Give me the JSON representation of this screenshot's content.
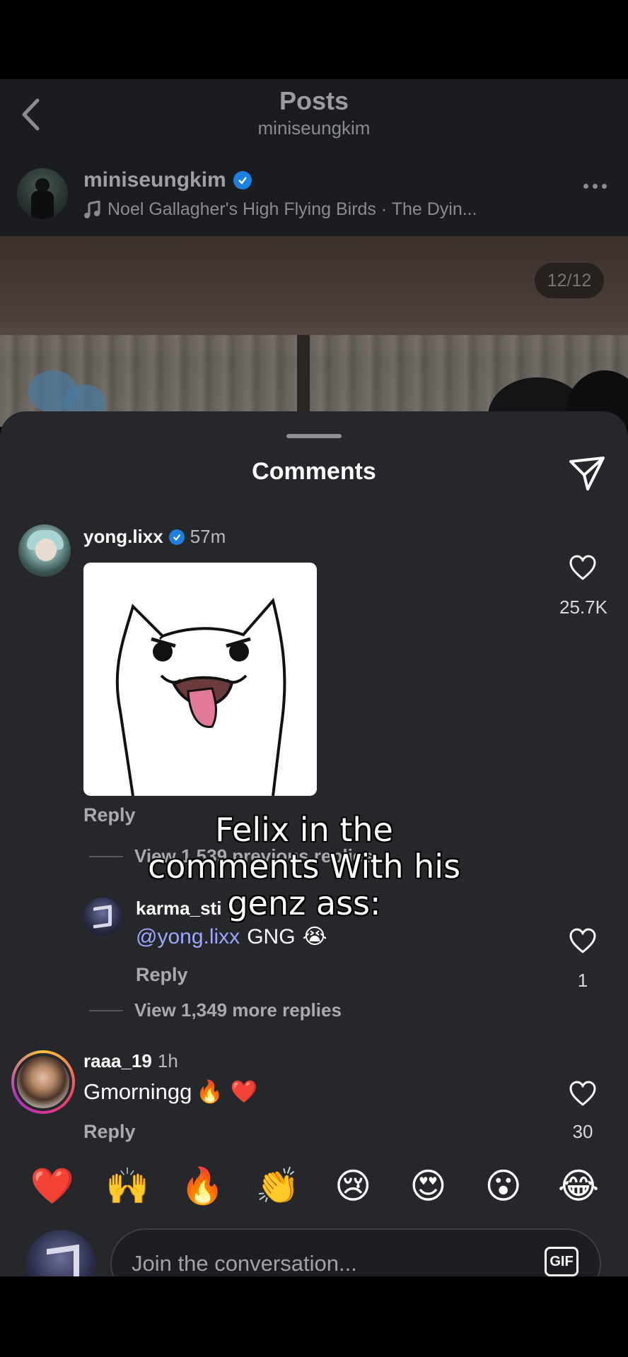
{
  "header": {
    "title": "Posts",
    "subtitle": "miniseungkim"
  },
  "post": {
    "username": "miniseungkim",
    "music": "Noel Gallagher's High Flying Birds · The Dyin...",
    "counter": "12/12"
  },
  "comments_sheet": {
    "title": "Comments",
    "items": [
      {
        "username": "yong.lixx",
        "verified": true,
        "time": "57m",
        "content": "gif-cat-tongue",
        "reply_label": "Reply",
        "likes": "25.7K",
        "view_previous": "View 1,539 previous replies",
        "replies": [
          {
            "username": "karma_sti",
            "mention": "@yong.lixx",
            "text": "GNG",
            "emoji": "😭",
            "reply_label": "Reply",
            "likes": "1"
          }
        ],
        "view_more": "View 1,349 more replies"
      },
      {
        "username": "raaa_19",
        "time": "1h",
        "text": "Gmorningg",
        "emojis": "🔥 ❤️",
        "reply_label": "Reply",
        "likes": "30"
      }
    ]
  },
  "emoji_bar": [
    "❤️",
    "🙌",
    "🔥",
    "👏",
    "😢",
    "😍",
    "😮",
    "😂"
  ],
  "input": {
    "placeholder": "Join the conversation...",
    "gif_label": "GIF"
  },
  "overlay_caption": {
    "line1": "Felix in the",
    "line2": "comments With his",
    "line3": "genz ass:"
  },
  "colors": {
    "sheet_bg": "#25272b",
    "verified": "#1d7fe0",
    "mention": "#9ea6ff"
  }
}
